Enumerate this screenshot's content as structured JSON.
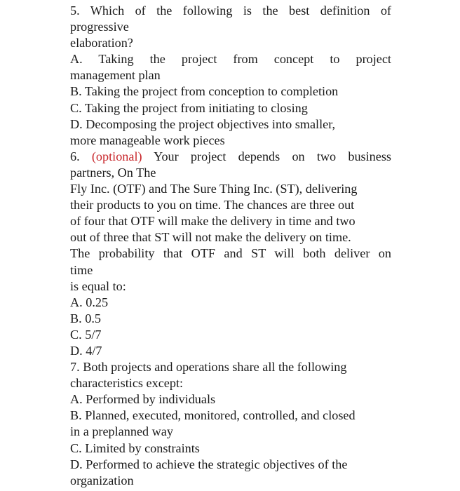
{
  "questions": [
    {
      "lines": [
        "5. Which of the following is the best definition of",
        "progressive",
        "elaboration?"
      ],
      "options": [
        [
          "A. Taking the project from concept to project",
          "management plan"
        ],
        [
          "B. Taking the project from conception to completion"
        ],
        [
          "C. Taking the project from initiating to closing"
        ],
        [
          "D. Decomposing the project objectives into smaller,",
          "more manageable work pieces"
        ]
      ]
    },
    {
      "number": "6.",
      "tag": "(optional)",
      "tag_color": "#c8262b",
      "first_line_rest": "Your project depends on two business",
      "lines": [
        "partners, On The",
        "Fly Inc. (OTF) and The Sure Thing Inc. (ST), delivering",
        "their products to you on time. The chances are three out",
        "of four that OTF will make the delivery in time and two",
        "out of three that ST will not make the delivery on time.",
        "The probability that OTF and ST will both deliver on",
        "time",
        "is equal to:"
      ],
      "options": [
        [
          "A. 0.25"
        ],
        [
          "B. 0.5"
        ],
        [
          "C. 5/7"
        ],
        [
          "D. 4/7"
        ]
      ]
    },
    {
      "lines": [
        "7. Both projects and operations share all the following",
        "characteristics except:"
      ],
      "options": [
        [
          "A. Performed by individuals"
        ],
        [
          "B. Planned, executed, monitored, controlled, and closed",
          "in a preplanned way"
        ],
        [
          "C. Limited by constraints"
        ],
        [
          "D. Performed to achieve the strategic objectives of the",
          "organization"
        ]
      ]
    }
  ]
}
